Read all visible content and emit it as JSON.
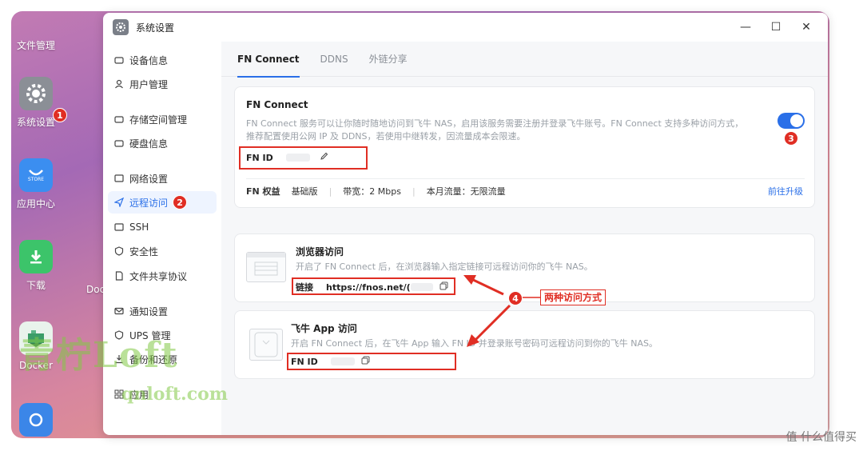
{
  "desktop": {
    "icons": [
      {
        "label": "文件管理"
      },
      {
        "label": "系统设置"
      },
      {
        "label": "应用中心",
        "sublabel": "STORE"
      },
      {
        "label": "下载"
      },
      {
        "label": "Docker"
      }
    ],
    "fragment": "Doc"
  },
  "window": {
    "title": "系统设置",
    "controls": {
      "minimize": "—",
      "maximize": "☐",
      "close": "✕"
    }
  },
  "sidebar": {
    "items": [
      {
        "label": "设备信息"
      },
      {
        "label": "用户管理"
      },
      {
        "label": "存储空间管理"
      },
      {
        "label": "硬盘信息"
      },
      {
        "label": "网络设置"
      },
      {
        "label": "远程访问"
      },
      {
        "label": "SSH"
      },
      {
        "label": "安全性"
      },
      {
        "label": "文件共享协议"
      },
      {
        "label": "通知设置"
      },
      {
        "label": "UPS 管理"
      },
      {
        "label": "备份和还原"
      },
      {
        "label": "应用"
      }
    ],
    "active": "远程访问"
  },
  "tabs": [
    {
      "label": "FN Connect"
    },
    {
      "label": "DDNS"
    },
    {
      "label": "外链分享"
    }
  ],
  "fn_connect": {
    "title": "FN Connect",
    "desc1": "FN Connect 服务可以让你随时随地访问到飞牛 NAS，启用该服务需要注册并登录飞牛账号。FN Connect 支持多种访问方式，",
    "desc2": "推荐配置使用公网 IP 及 DDNS，若使用中继转发，因流量成本会限速。",
    "fn_id_label": "FN ID",
    "toggle_on": true,
    "rights_label": "FN 权益",
    "rights_plan": "基础版",
    "bandwidth": "带宽：2 Mbps",
    "traffic": "本月流量：无限流量",
    "upgrade": "前往升级"
  },
  "browser_access": {
    "title": "浏览器访问",
    "desc": "开启了 FN Connect 后，在浏览器输入指定链接可远程访问你的飞牛 NAS。",
    "link_label": "链接",
    "link_value": "https://fnos.net/("
  },
  "app_access": {
    "title": "飞牛 App 访问",
    "desc": "开启 FN Connect 后，在飞牛 App 输入 FN ID 并登录账号密码可远程访问到你的飞牛 NAS。",
    "fn_id_label": "FN ID"
  },
  "annotations": {
    "badge1": "1",
    "badge2": "2",
    "badge3": "3",
    "badge4": "4",
    "label": "两种访问方式",
    "color": "#e02e24"
  },
  "watermark": {
    "big": "青柠Loft",
    "small": "qnloft.com"
  },
  "site_mark": "值 什么值得买",
  "colors": {
    "accent": "#2a6fe8",
    "annotation": "#e02e24"
  }
}
